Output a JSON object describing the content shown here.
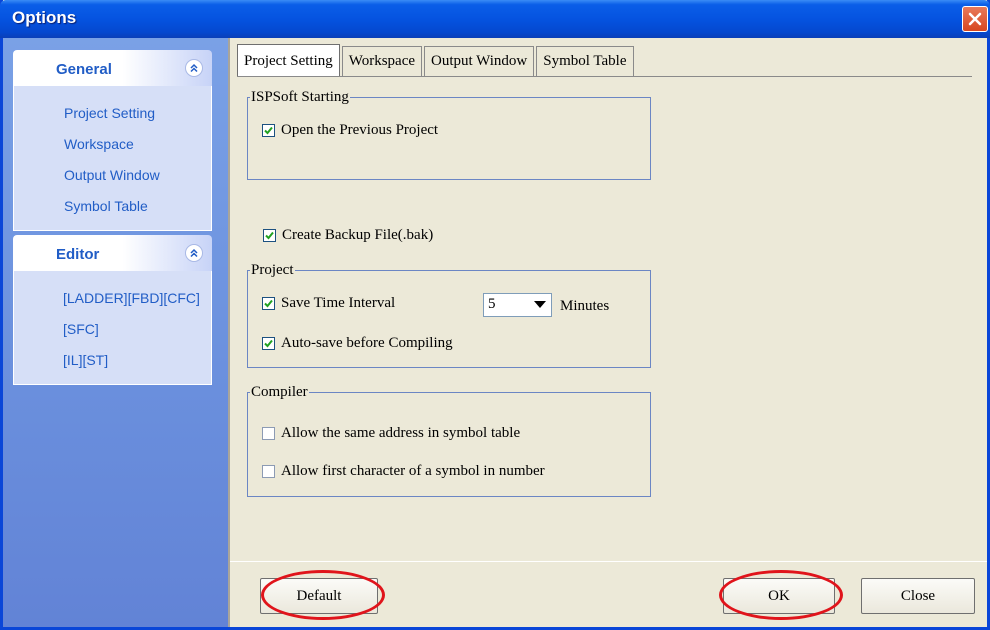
{
  "window": {
    "title": "Options"
  },
  "nav": {
    "groups": [
      {
        "title": "General",
        "items": [
          "Project Setting",
          "Workspace",
          "Output Window",
          "Symbol Table"
        ]
      },
      {
        "title": "Editor",
        "items": [
          "[LADDER][FBD][CFC]",
          "[SFC]",
          "[IL][ST]"
        ]
      }
    ]
  },
  "tabs": [
    {
      "label": "Project Setting",
      "active": true
    },
    {
      "label": "Workspace",
      "active": false
    },
    {
      "label": "Output Window",
      "active": false
    },
    {
      "label": "Symbol Table",
      "active": false
    }
  ],
  "startup": {
    "legend": "ISPSoft Starting",
    "open_previous_label": "Open the Previous Project",
    "open_previous_checked": true
  },
  "backup": {
    "label": "Create Backup File(.bak)",
    "checked": true
  },
  "project": {
    "legend": "Project",
    "save_interval_label": "Save Time Interval",
    "save_interval_checked": true,
    "interval_value": "5",
    "interval_unit": "Minutes",
    "autosave_label": "Auto-save before Compiling",
    "autosave_checked": true
  },
  "compiler": {
    "legend": "Compiler",
    "same_address_label": "Allow the same address in symbol table",
    "same_address_checked": false,
    "first_char_label": "Allow first character of a symbol in number",
    "first_char_checked": false
  },
  "buttons": {
    "default": "Default",
    "ok": "OK",
    "close": "Close"
  },
  "colors": {
    "title_blue": "#0553e0",
    "nav_link": "#215dc6",
    "highlight_red": "#e0141b"
  }
}
